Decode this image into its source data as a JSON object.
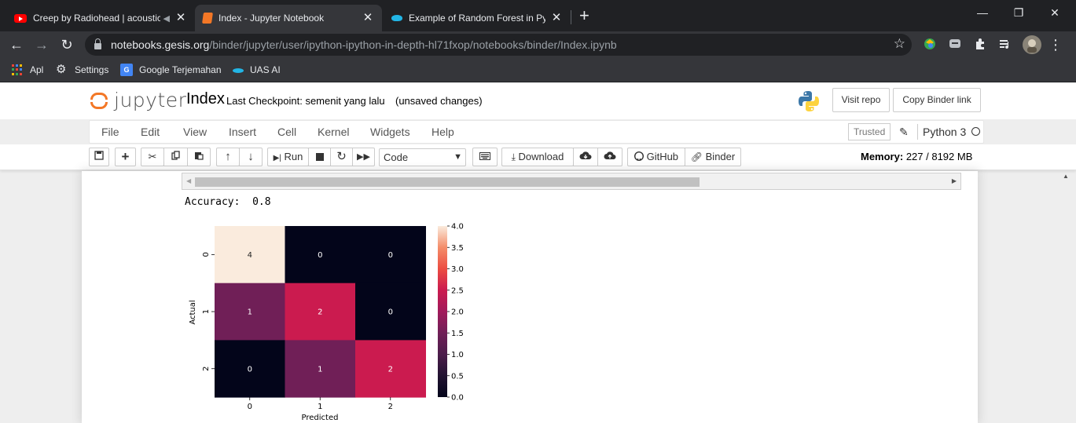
{
  "browser": {
    "tabs": [
      {
        "title": "Creep by Radiohead | acoustic",
        "favicon": "youtube-icon",
        "active": false
      },
      {
        "title": "Index - Jupyter Notebook",
        "favicon": "jupyter-icon",
        "active": true
      },
      {
        "title": "Example of Random Forest in Pyt",
        "favicon": "random-forest-icon",
        "active": false
      }
    ],
    "new_tab": "+",
    "window_controls": {
      "minimize": "—",
      "restore": "❐",
      "close": "✕"
    },
    "nav": {
      "back": "←",
      "forward": "→",
      "reload": "↻"
    },
    "url_host": "notebooks.gesis.org",
    "url_path": "/binder/jupyter/user/ipython-ipython-in-depth-hl71fxop/notebooks/binder/Index.ipynb",
    "star": "☆",
    "bookmarks": [
      {
        "label": "Apl",
        "icon": "apps-icon"
      },
      {
        "label": "Settings",
        "icon": "gear-icon"
      },
      {
        "label": "Google Terjemahan",
        "icon": "google-translate-icon"
      },
      {
        "label": "UAS AI",
        "icon": "uas-ai-icon"
      }
    ]
  },
  "jupyter": {
    "logo_text": "jupyter",
    "notebook_name": "Index",
    "checkpoint": "Last Checkpoint: semenit yang lalu",
    "autosave": "(unsaved changes)",
    "visit_repo": "Visit repo",
    "copy_binder": "Copy Binder link",
    "menus": [
      "File",
      "Edit",
      "View",
      "Insert",
      "Cell",
      "Kernel",
      "Widgets",
      "Help"
    ],
    "trusted": "Trusted",
    "kernel_name": "Python 3",
    "toolbar": {
      "run": "Run",
      "cell_type": "Code",
      "download": "Download",
      "github": "GitHub",
      "binder": "Binder"
    },
    "memory_label": "Memory:",
    "memory_value": "227 / 8192 MB"
  },
  "output": {
    "accuracy_text": "Accuracy:  0.8"
  },
  "chart_data": {
    "type": "heatmap",
    "xlabel": "Predicted",
    "ylabel": "Actual",
    "x_categories": [
      "0",
      "1",
      "2"
    ],
    "y_categories": [
      "0",
      "1",
      "2"
    ],
    "values": [
      [
        4,
        0,
        0
      ],
      [
        1,
        2,
        0
      ],
      [
        0,
        1,
        2
      ]
    ],
    "annotations": [
      [
        "4",
        "0",
        "0"
      ],
      [
        "1",
        "2",
        "0"
      ],
      [
        "0",
        "1",
        "2"
      ]
    ],
    "colorbar_ticks": [
      "0.0",
      "0.5",
      "1.0",
      "1.5",
      "2.0",
      "2.5",
      "3.0",
      "3.5",
      "4.0"
    ],
    "vmin": 0,
    "vmax": 4,
    "colormap": "rocket",
    "cell_colors": {
      "0": "#03051a",
      "1": "#701f57",
      "2": "#cb1b4f",
      "4": "#faebdd"
    }
  }
}
